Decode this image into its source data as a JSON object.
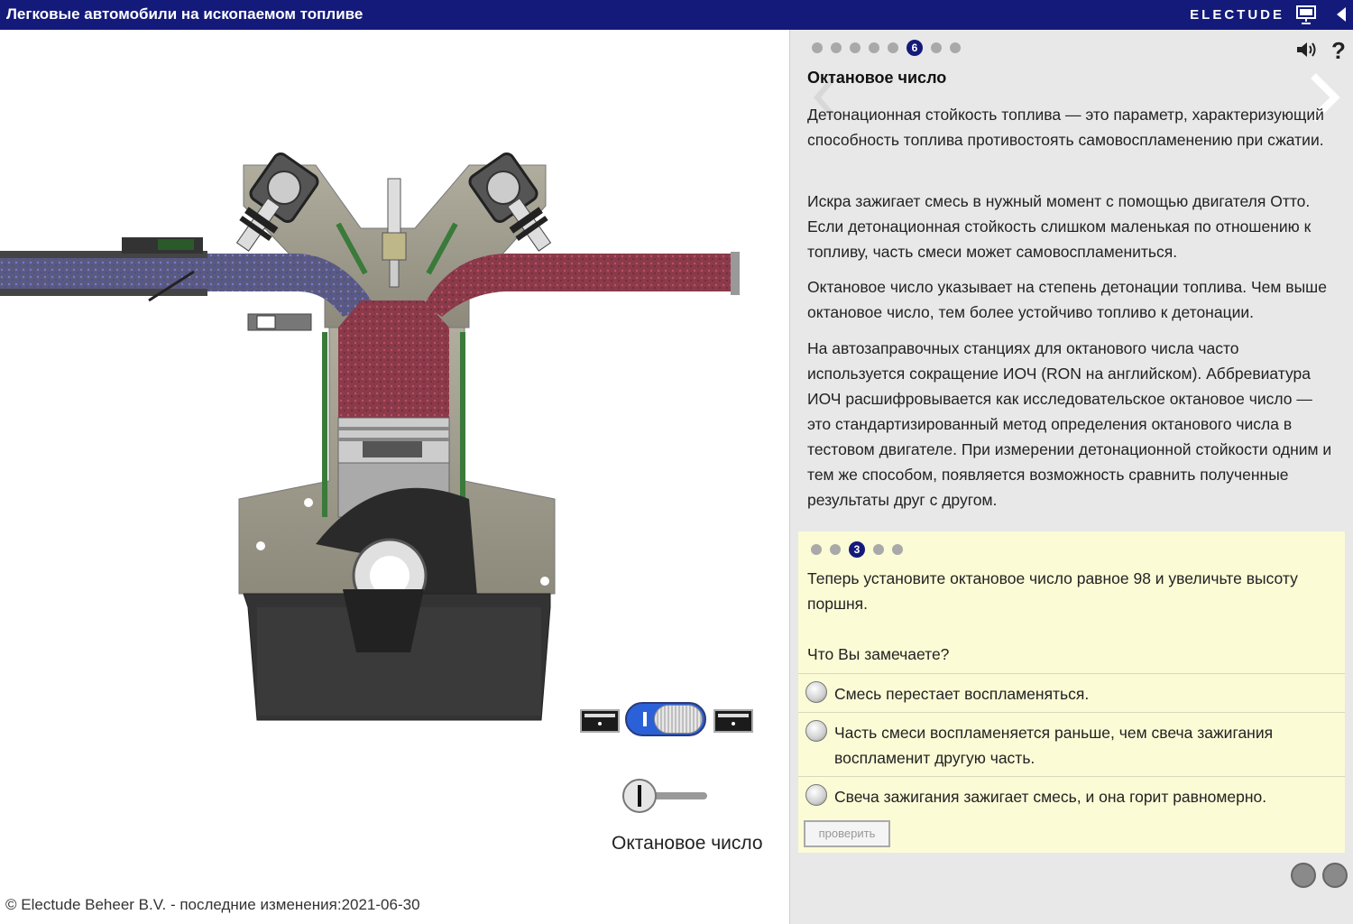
{
  "header": {
    "title": "Легковые автомобили на ископаемом топливе",
    "brand": "ELECTUDE"
  },
  "left": {
    "footer": "© Electude Beheer B.V. - последние изменения:2021-06-30",
    "slider_label": "Октановое число",
    "toggle_state": "on"
  },
  "panel": {
    "page_dots": 8,
    "active_page": "6",
    "section_title": "Октановое число",
    "paragraphs": [
      "Детонационная стойкость топлива — это параметр, характеризующий способность топлива противостоять самовоспламенению при сжатии.",
      "Искра зажигает смесь в нужный момент с помощью двигателя Отто. Если детонационная стойкость слишком маленькая по отношению к топливу, часть смеси может самовоспламениться.",
      "Октановое число указывает на степень детонации топлива. Чем выше октановое число, тем более устойчиво топливо к детонации.",
      "На автозаправочных станциях для октанового числа часто используется сокращение ИОЧ (RON на английском). Аббревиатура ИОЧ расшифровывается как исследовательское октановое число — это стандартизированный метод определения октанового числа в тестовом двигателе. При измерении детонационной стойкости одним и тем же способом, появляется возможность сравнить полученные результаты друг с другом."
    ]
  },
  "question": {
    "dots": 5,
    "active": "3",
    "prompt": "Теперь установите октановое число равное 98 и увеличьте высоту поршня.",
    "ask": "Что Вы замечаете?",
    "options": [
      "Смесь перестает воспламеняться.",
      "Часть смеси воспламеняется раньше, чем свеча зажигания воспламенит другую часть.",
      "Свеча зажигания зажигает смесь, и она горит равномерно."
    ],
    "check_label": "проверить"
  },
  "colors": {
    "header_bg": "#141a7a",
    "panel_bg": "#e8e8e8",
    "question_bg": "#fbfbd6",
    "toggle_blue": "#2a61d8"
  }
}
